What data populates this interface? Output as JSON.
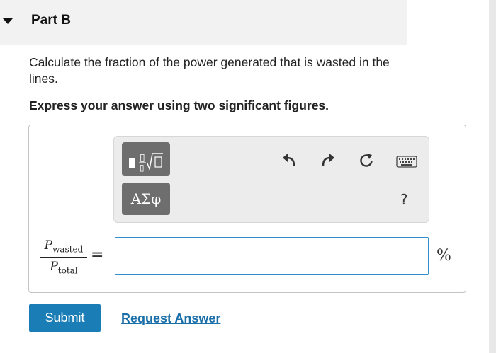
{
  "part": {
    "title": "Part B"
  },
  "question": {
    "text": "Calculate the fraction of the power generated that is wasted in the lines.",
    "instruction": "Express your answer using two significant figures."
  },
  "toolbar": {
    "greek_label": "ΑΣφ",
    "help_label": "?",
    "icons": [
      "templates-icon",
      "greek-letters-icon",
      "undo-icon",
      "redo-icon",
      "reset-icon",
      "keyboard-icon",
      "help-icon"
    ]
  },
  "answer": {
    "lhs_numerator": "P",
    "lhs_numerator_sub": "wasted",
    "lhs_denominator": "P",
    "lhs_denominator_sub": "total",
    "equals": "=",
    "value": "",
    "unit": "%"
  },
  "actions": {
    "submit_label": "Submit",
    "request_label": "Request Answer"
  },
  "colors": {
    "accent": "#1b7db6",
    "input_border": "#2f8cc9",
    "toolbar_button": "#6e6e6e"
  }
}
